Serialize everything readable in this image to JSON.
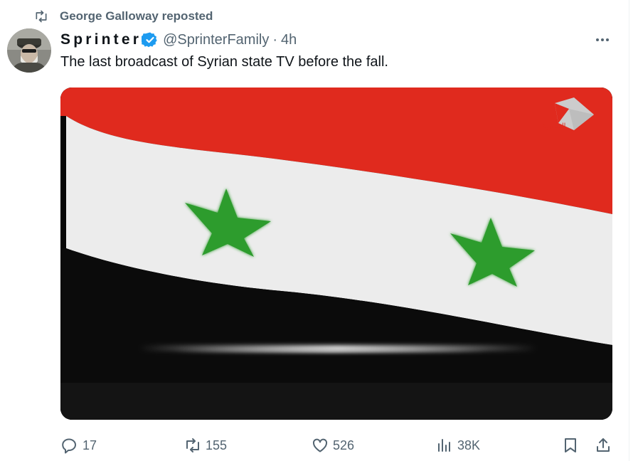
{
  "repost": {
    "label": "George Galloway reposted",
    "icon": "repost-icon"
  },
  "author": {
    "display_name": "Sprinter",
    "verified": true,
    "verified_color": "#1d9bf0",
    "handle": "@SprinterFamily",
    "separator": "·",
    "time": "4h"
  },
  "tweet": {
    "text": "The last broadcast of Syrian state TV before the fall."
  },
  "media": {
    "type": "video-still",
    "description_icon": "syrian-flag",
    "channel_logo_text": "السورية",
    "colors": {
      "red": "#e02a1e",
      "white": "#eeeeee",
      "black": "#0a0a0a",
      "star": "#2c9a2c"
    }
  },
  "actions": {
    "replies": "17",
    "reposts": "155",
    "likes": "526",
    "views": "38K"
  },
  "colors": {
    "text_primary": "#0f1419",
    "text_secondary": "#536471",
    "accent": "#1d9bf0"
  }
}
